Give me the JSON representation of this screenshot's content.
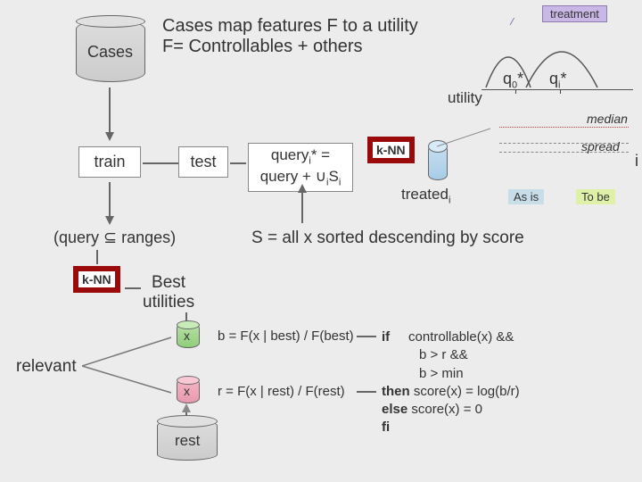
{
  "header": {
    "line1": "Cases map features F to a utility",
    "line2": "F= Controllables + others"
  },
  "cases_label": "Cases",
  "train_label": "train",
  "test_label": "test",
  "query_box": {
    "line1_a": "query",
    "line1_b": "* =",
    "line2_a": "query + ",
    "line2_b": "∪",
    "line2_c": "S"
  },
  "knn_label": "k-NN",
  "treated_label_a": "treated",
  "treated_sub": "i",
  "as_is_label": "As is",
  "to_be_label": "To be",
  "query_ranges": "(query ⊆ ranges)",
  "s_statement": "S = all x sorted descending by  score",
  "best_utilities": "Best\nutilities",
  "x_label": "x",
  "rest_label": "rest",
  "relevant_label": "relevant",
  "formula_b": "b = F(x | best) / F(best)",
  "formula_r": "r = F(x | rest) / F(rest)",
  "pseudocode": {
    "if": "if",
    "cond1": "controllable(x) &&",
    "cond2": "b > r  &&",
    "cond3": "b > min",
    "then": "then",
    "then_body": "score(x) = log(b/r)",
    "else": "else",
    "else_body": "score(x) = 0",
    "fi": "fi"
  },
  "chart": {
    "treatment": "treatment",
    "q0": "q",
    "q0_sub": "0",
    "qi": "q",
    "qi_sub": "i",
    "star": "*",
    "utility": "utility",
    "median": "median",
    "spread": "spread",
    "i_label": "i"
  },
  "chart_data": {
    "type": "line",
    "title": "",
    "xlabel": "utility",
    "ylabel": "",
    "annotations": [
      "treatment",
      "median",
      "spread"
    ],
    "x_markers": [
      "q0*",
      "qi*"
    ],
    "legend": [
      "As is",
      "To be"
    ],
    "note": "Two overlapping distribution curves; the 'To be' curve is shifted to higher utility relative to 'As is'. Exact values not labeled."
  }
}
